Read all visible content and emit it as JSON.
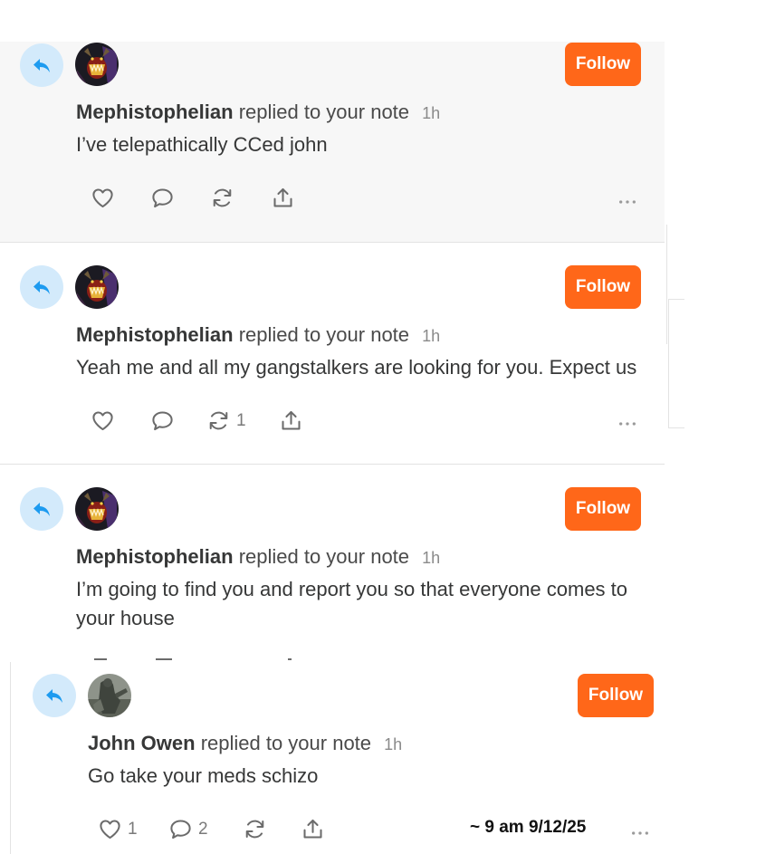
{
  "colors": {
    "follow": "#ff6719",
    "reply_badge_bg": "#d3eafb",
    "reply_badge_icon": "#1d9bf0"
  },
  "icons": [
    "reply-arrow-icon",
    "heart-icon",
    "comment-icon",
    "restack-icon",
    "share-icon",
    "more-icon"
  ],
  "notes": [
    {
      "author": "Mephistophelian",
      "action": "replied to your note",
      "time": "1h",
      "text": "I’ve telepathically CCed john",
      "follow_label": "Follow",
      "likes": "",
      "comments": "",
      "restacks": ""
    },
    {
      "author": "Mephistophelian",
      "action": "replied to your note",
      "time": "1h",
      "text": "Yeah me and all my gangstalkers are looking for you. Expect us",
      "follow_label": "Follow",
      "likes": "",
      "comments": "",
      "restacks": "1"
    },
    {
      "author": "Mephistophelian",
      "action": "replied to your note",
      "time": "1h",
      "text": "I’m going to find you and report you so that everyone comes to your house",
      "follow_label": "Follow"
    },
    {
      "author": "John Owen",
      "action": "replied to your note",
      "time": "1h",
      "text": "Go take your meds schizo",
      "follow_label": "Follow",
      "likes": "1",
      "comments": "2",
      "restacks": ""
    }
  ],
  "annotation": "~ 9 am 9/12/25"
}
